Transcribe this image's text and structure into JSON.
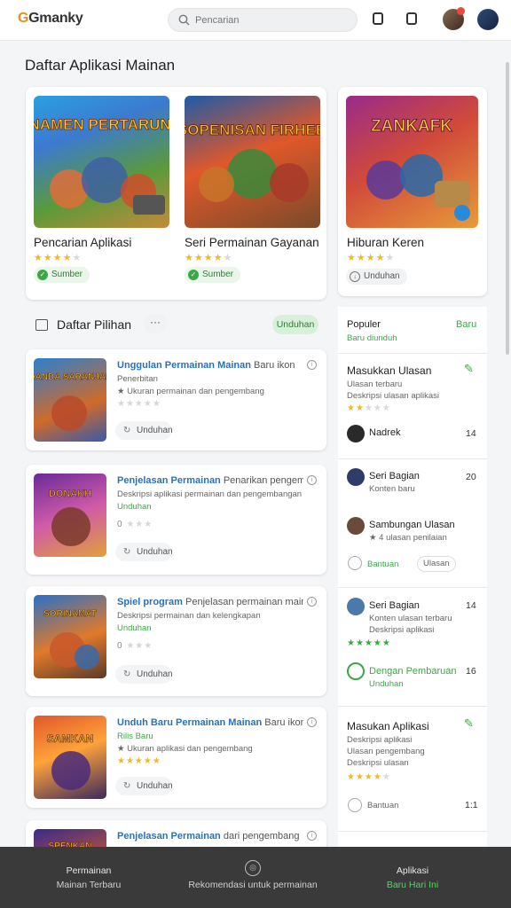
{
  "header": {
    "logo": "Gmanky",
    "search_placeholder": "Pencarian"
  },
  "page_title": "Daftar Aplikasi Mainan",
  "featured": [
    {
      "art_text": "TURNAMEN PERTARUNGAN",
      "title": "Pencarian Aplikasi",
      "rating": 4,
      "pill": "Sumber",
      "pill_style": "green"
    },
    {
      "art_text": "SOPENISAN FIRHEB",
      "title": "Seri Permainan Gayanan",
      "rating": 4.5,
      "pill": "Sumber",
      "pill_style": "green"
    },
    {
      "art_text": "ZANKAFK",
      "title": "Hiburan Keren",
      "rating": 4.5,
      "pill": "Unduhan",
      "pill_style": "gray"
    }
  ],
  "list_header": {
    "label": "Daftar Pilihan",
    "more": "···",
    "button": "Unduhan"
  },
  "list_items": [
    {
      "art_text": "OANDA SARANJAN",
      "title": "Unggulan Permainan Mainan",
      "title_rest": "Baru ikon",
      "sub1": "Penerbitan",
      "sub2": "★ Ukuran permainan dan pengembang",
      "sub2_style": "gray",
      "rating": 0,
      "button": "Unduhan"
    },
    {
      "art_text": "DONAKH",
      "title": "Penjelasan Permainan",
      "title_rest": "Penarikan pengembang",
      "sub1": "Deskripsi aplikasi permainan dan pengembangan",
      "sub2": "Unduhan",
      "sub2_style": "green",
      "rating": 0,
      "button": "Unduhan"
    },
    {
      "art_text": "SORINAMAT",
      "title": "Spiel program",
      "title_rest": "Penjelasan permainan mainan",
      "sub1": "Deskripsi permainan dan kelengkapan",
      "sub2": "Unduhan",
      "sub2_style": "green",
      "rating": 0,
      "button": "Unduhan"
    },
    {
      "art_text": "SAMKAN",
      "title": "Unduh Baru Permainan Mainan",
      "title_rest": "Baru ikon",
      "sub1": "Rilis Baru",
      "sub2": "★ Ukuran aplikasi dan pengembang",
      "sub2_style": "gray",
      "rating": 5,
      "button": "Unduhan"
    },
    {
      "art_text": "SPENKAN",
      "title": "Penjelasan Permainan",
      "title_rest": "dari pengembang",
      "sub1": "",
      "sub2": "",
      "sub2_style": "gray",
      "rating": 0,
      "button": "Unduhan"
    }
  ],
  "side": {
    "top_title": "Populer",
    "top_title_link": "Baru",
    "top_sub": "Baru diunduh",
    "block1": {
      "title": "Masukkan Ulasan",
      "sub1": "Ulasan terbaru",
      "sub2": "Deskripsi ulasan aplikasi",
      "rating": 2
    },
    "people": [
      {
        "name": "Nadrek",
        "sub": "",
        "num": "14",
        "avatar": "#3a3a3a"
      },
      {
        "name": "Seri Bagian",
        "sub": "Konten baru",
        "num": "20",
        "avatar": "#2f3b68"
      },
      {
        "name": "Sambungan Ulasan",
        "sub": "★ 4 ulasan penilaian",
        "num": "",
        "avatar": "#6a4a3a"
      }
    ],
    "action_left": "Bantuan",
    "action_right": "Ulasan",
    "block2": {
      "name": "Seri Bagian",
      "sub1": "Konten ulasan terbaru",
      "sub2": "Deskripsi aplikasi",
      "num": "14",
      "rating": 5
    },
    "block3": {
      "name": "Dengan Pembaruan",
      "sub": "Unduhan",
      "num": "16"
    },
    "block4": {
      "title": "Masukan Aplikasi",
      "sub1": "Deskripsi aplikasi",
      "sub2": "Ulasan pengembang",
      "sub3": "Deskripsi ulasan",
      "rating": 4,
      "footer": "Bantuan",
      "footer_num": "1:1"
    }
  },
  "bottom_bar": {
    "items": [
      {
        "line1": "Permainan",
        "line2": "Mainan Terbaru",
        "green": false
      },
      {
        "line1": "",
        "line2": "Rekomendasi untuk permainan",
        "green": false
      },
      {
        "line1": "Aplikasi",
        "line2": "Baru Hari Ini",
        "green": true
      }
    ]
  },
  "colors": {
    "accent_green": "#3aa845",
    "link_blue": "#2a72b8",
    "star": "#f2b824",
    "bottom_bar": "#3a3a3a"
  }
}
